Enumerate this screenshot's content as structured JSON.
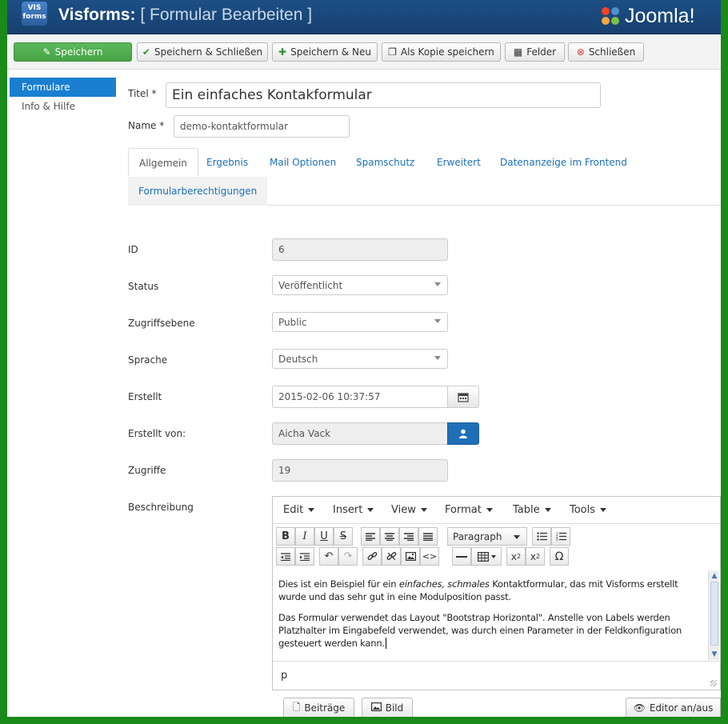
{
  "header": {
    "logo_text": "VIS forms",
    "app_name": "Visforms:",
    "page_title": "[ Formular Bearbeiten ]",
    "brand": "Joomla!"
  },
  "toolbar": {
    "save": "Speichern",
    "save_close": "Speichern & Schließen",
    "save_new": "Speichern & Neu",
    "save_copy": "Als Kopie speichern",
    "fields": "Felder",
    "close": "Schließen"
  },
  "sidebar": {
    "items": [
      {
        "label": "Formulare",
        "active": true
      },
      {
        "label": "Info & Hilfe",
        "active": false
      }
    ]
  },
  "form": {
    "title_label": "Titel *",
    "title_value": "Ein einfaches Kontakformular",
    "name_label": "Name *",
    "name_value": "demo-kontaktformular"
  },
  "tabs": [
    {
      "label": "Allgemein",
      "active": true
    },
    {
      "label": "Ergebnis"
    },
    {
      "label": "Mail Optionen"
    },
    {
      "label": "Spamschutz"
    },
    {
      "label": "Erweitert"
    },
    {
      "label": "Datenanzeige im Frontend"
    },
    {
      "label": "Formularberechtigungen"
    }
  ],
  "fields": {
    "id_label": "ID",
    "id_value": "6",
    "status_label": "Status",
    "status_value": "Veröffentlicht",
    "access_label": "Zugriffsebene",
    "access_value": "Public",
    "language_label": "Sprache",
    "language_value": "Deutsch",
    "created_label": "Erstellt",
    "created_value": "2015-02-06 10:37:57",
    "created_by_label": "Erstellt von:",
    "created_by_value": "Aicha Vack",
    "hits_label": "Zugriffe",
    "hits_value": "19",
    "description_label": "Beschreibung"
  },
  "editor": {
    "menus": [
      "Edit",
      "Insert",
      "View",
      "Format",
      "Table",
      "Tools"
    ],
    "format_select": "Paragraph",
    "p1_before": "Dies ist ein Beispiel für ein ",
    "p1_italic": "einfaches, schmales",
    "p1_after": " Kontaktformular, das mit Visforms erstellt wurde und das sehr gut in eine Modulposition passt.",
    "p2": "Das Formular verwendet das Layout \"Bootstrap Horizontal\". Anstelle von Labels werden Platzhalter im Eingabefeld verwendet, was durch einen Parameter in der Feldkonfiguration gesteuert werden kann.",
    "status_path": "p"
  },
  "bottom_buttons": {
    "articles": "Beiträge",
    "image": "Bild",
    "toggle_editor": "Editor an/aus"
  }
}
